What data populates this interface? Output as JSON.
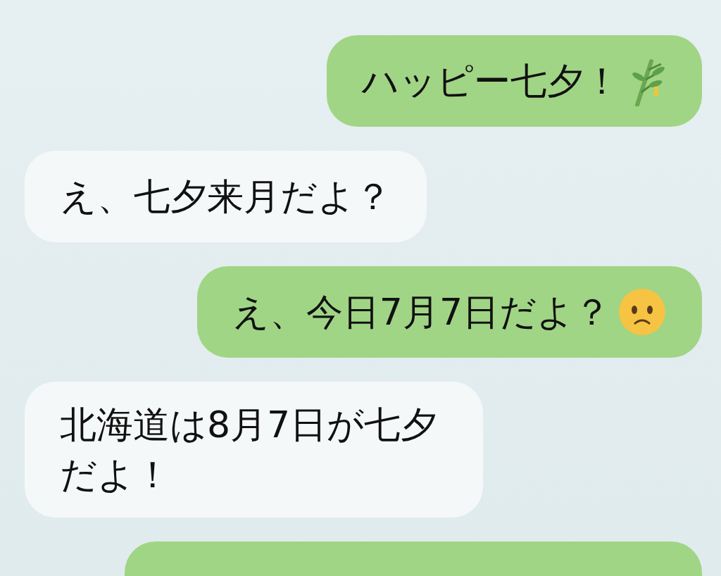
{
  "messages": [
    {
      "kind": "sent",
      "text": "ハッピー七夕！",
      "icon": {
        "kind": "bamboo"
      }
    },
    {
      "kind": "received",
      "text": "え、七夕来月だよ？"
    },
    {
      "kind": "sent",
      "text": "え、今日7月7日だよ？",
      "icon": {
        "kind": "worried-face"
      }
    },
    {
      "kind": "received",
      "text": "北海道は8月7日が七夕だよ！"
    },
    {
      "kind": "sent"
    }
  ]
}
